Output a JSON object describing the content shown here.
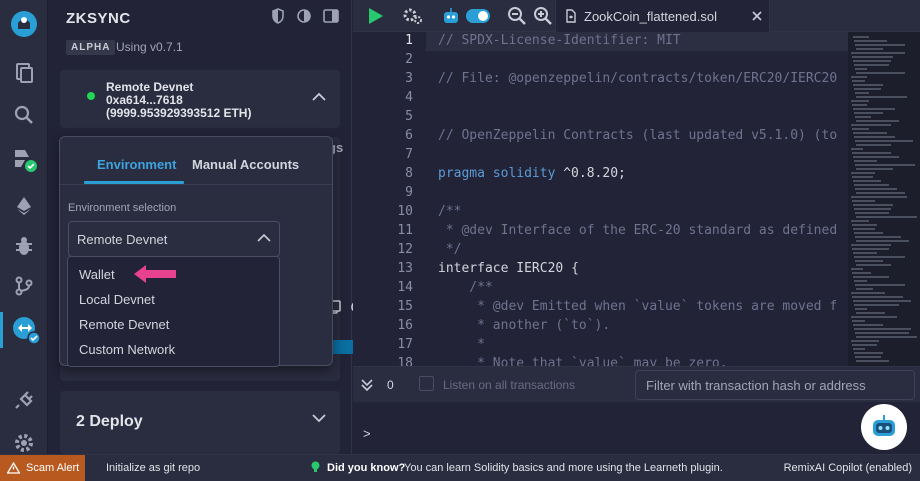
{
  "sidebar_panel": {
    "title": "ZKSYNC",
    "badge": "ALPHA",
    "version": "Using v0.7.1"
  },
  "account": {
    "network": "Remote Devnet",
    "address": "0xa614...7618",
    "balance": "(9999.953929393512 ETH)",
    "status_color": "#1fd655"
  },
  "environment": {
    "tabs": [
      "Environment",
      "Manual Accounts"
    ],
    "active_tab": "Environment",
    "selection_label": "Environment selection",
    "selected": "Remote Devnet",
    "options": [
      "Wallet",
      "Local Devnet",
      "Remote Devnet",
      "Custom Network"
    ],
    "tail_text": "gs"
  },
  "deploy": {
    "label": "2  Deploy"
  },
  "editor": {
    "file_tab": "ZookCoin_flattened.sol",
    "line_numbers": [
      "1",
      "2",
      "3",
      "4",
      "5",
      "6",
      "7",
      "8",
      "9",
      "10",
      "11",
      "12",
      "13",
      "14",
      "15",
      "16",
      "17",
      "18"
    ],
    "current_line": "1",
    "lines": {
      "l1": "// SPDX-License-Identifier: MIT",
      "l3": "// File: @openzeppelin/contracts/token/ERC20/IERC20",
      "l6": "// OpenZeppelin Contracts (last updated v5.1.0) (to",
      "l8_kw": "pragma solidity",
      "l8_tx": " ^0.8.20;",
      "l10": "/**",
      "l11": " * @dev Interface of the ERC-20 standard as defined",
      "l12": " */",
      "l13_kw": "interface",
      "l13_tx": " IERC20 {",
      "l14": "    /**",
      "l15": "     * @dev Emitted when `value` tokens are moved f",
      "l16": "     * another (`to`).",
      "l17": "     *",
      "l18": "     * Note that `value` may be zero."
    }
  },
  "terminal": {
    "count": "0",
    "listen_label": "Listen on all transactions",
    "filter_placeholder": "Filter with transaction hash or address",
    "prompt": ">"
  },
  "statusbar": {
    "scam_alert": "Scam Alert",
    "git": "Initialize as git repo",
    "did_you_know": "Did you know?",
    "tip": "You can learn Solidity basics and more using the Learneth plugin.",
    "copilot": "RemixAI Copilot (enabled)"
  },
  "colors": {
    "accent": "#2a9fd6",
    "run_green": "#27c86e",
    "arrow_pink": "#e8418f",
    "scam_orange": "#b85a1f"
  },
  "icons": [
    "remix-logo-icon",
    "file-explorer-icon",
    "search-icon",
    "solidity-compiler-icon",
    "deploy-run-icon",
    "debugger-icon",
    "git-icon",
    "zksync-icon",
    "plugin-manager-icon",
    "settings-icon",
    "run-icon",
    "settings-gear-icon",
    "ai-bot-icon",
    "toggle-icon",
    "zoom-out-icon",
    "zoom-in-icon",
    "file-icon",
    "close-icon",
    "shield-icon",
    "half-moon-icon",
    "panel-icon",
    "chevron-up-icon",
    "chevron-down-icon",
    "copy-icon",
    "refresh-icon",
    "double-chevron-icon",
    "pink-arrow-icon",
    "bulb-icon",
    "warning-icon"
  ]
}
